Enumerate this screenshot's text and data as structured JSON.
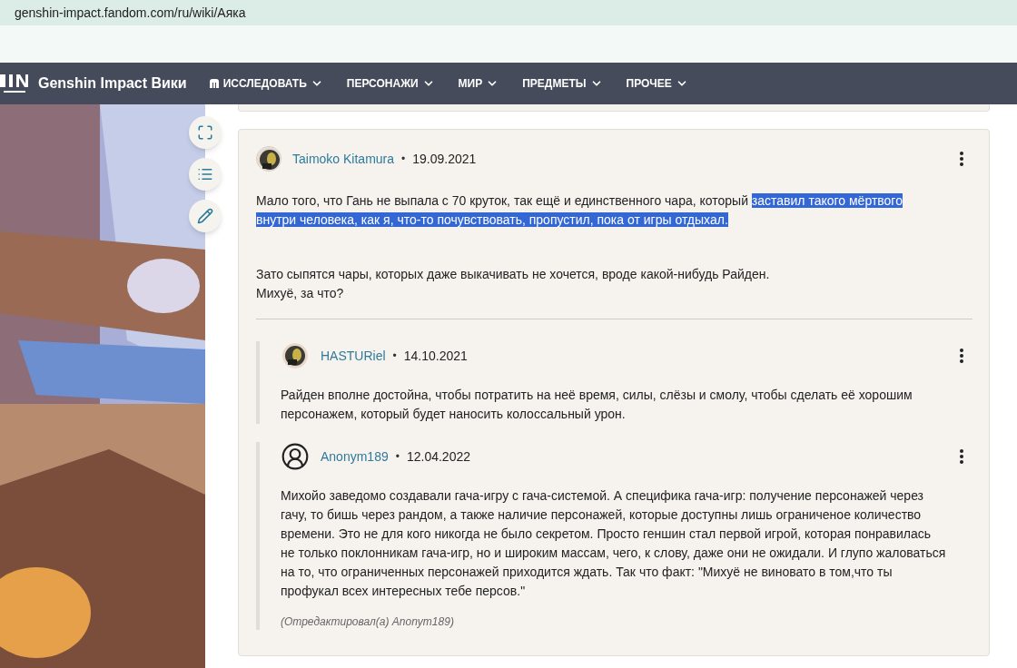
{
  "browser": {
    "url": "genshin-impact.fandom.com/ru/wiki/Аяка"
  },
  "nav": {
    "site_title": "Genshin Impact Вики",
    "items": [
      {
        "label": "ИССЛЕДОВАТЬ",
        "kind": "explore"
      },
      {
        "label": "ПЕРСОНАЖИ",
        "kind": "menu"
      },
      {
        "label": "МИР",
        "kind": "menu"
      },
      {
        "label": "ПРЕДМЕТЫ",
        "kind": "menu"
      },
      {
        "label": "ПРОЧЕЕ",
        "kind": "menu"
      }
    ]
  },
  "side_tools": [
    {
      "kind": "expand"
    },
    {
      "kind": "contents"
    },
    {
      "kind": "edit"
    }
  ],
  "comment": {
    "author": "Taimoko Kitamura",
    "kind": "photo_avatar",
    "separator": "•",
    "date": "19.09.2021",
    "paragraphs": [
      [
        {
          "text": "Мало того, что Гань не выпала с 70 круток, так ещё и единственного чара, который ",
          "highlighted": false
        },
        {
          "text": "заставил такого мёртвого внутри человека, как я, что-то почувствовать, пропустил, пока от игры отдыхал.",
          "highlighted": true
        }
      ],
      [
        {
          "text": "Зато сыпятся чары, которых даже выкачивать не хочется, вроде какой-нибудь Райден.\nМихуё, за что?",
          "highlighted": false
        }
      ]
    ],
    "replies": [
      {
        "author": "HASTURiel",
        "kind": "photo_avatar",
        "separator": "•",
        "date": "14.10.2021",
        "text": "Райден вполне достойна, чтобы потратить на неё время, силы, слёзы и смолу, чтобы сделать её хорошим персонажем, который будет наносить колоссальный урон."
      },
      {
        "author": "Anonym189",
        "kind": "default_avatar",
        "separator": "•",
        "date": "12.04.2022",
        "text": "Михойо заведомо создавали гача-игру с гача-системой. А специфика гача-игр: получение персонажей через гачу, то бишь через рандом, а также наличие персонажей, которые доступны лишь ограниченое количество времени. Это не для кого никогда не было секретом. Просто геншин стал первой игрой, которая понравилась не только поклонникам гача-игр, но и широким массам, чего, к слову, даже они не ожидали. И глупо жаловаться на то, что ограниченных персонажей приходится ждать. Так что факт: \"Михуё не виновато в том,что ты профукал всех интересных тебе персов.\"",
        "edited_note": "(Отредактировал(а) Anonym189)"
      }
    ]
  }
}
